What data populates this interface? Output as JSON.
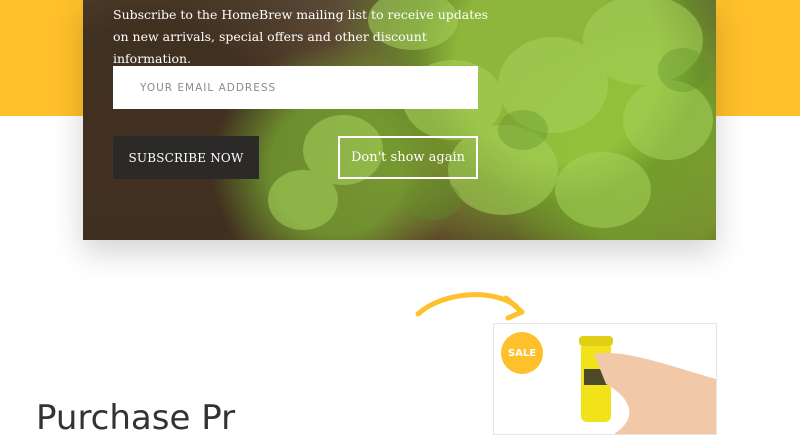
{
  "newsletter": {
    "description": "Subscribe to the HomeBrew mailing list to receive updates on new arrivals, special offers and other discount information.",
    "email_placeholder": "YOUR EMAIL ADDRESS",
    "subscribe_label": "SUBSCRIBE NOW",
    "dismiss_label": "Don't show again"
  },
  "product": {
    "badge_label": "SALE"
  },
  "section": {
    "heading_partial": "Purchase Pr"
  },
  "colors": {
    "accent": "#fec02b",
    "button_dark": "#2b2a29"
  },
  "icons": {
    "arrow": "curved-arrow-icon"
  }
}
